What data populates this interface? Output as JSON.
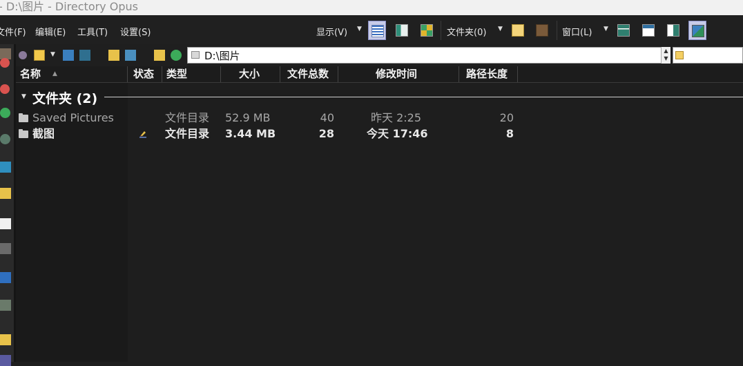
{
  "window": {
    "title": "- D:\\图片 - Directory Opus"
  },
  "menu": {
    "file": "文件(F)",
    "edit": "编辑(E)",
    "tools": "工具(T)",
    "settings": "设置(S)"
  },
  "toolbar": {
    "display_label": "显示(V)",
    "folder_label": "文件夹(0)",
    "window_label": "窗口(L)",
    "active_view_button": "details-view",
    "active_window_button": "layout-dual-image"
  },
  "location": {
    "path": "D:\\图片",
    "search_value": ""
  },
  "columns": [
    {
      "label": "名称",
      "sort": "ascending"
    },
    {
      "label": "状态"
    },
    {
      "label": "类型"
    },
    {
      "label": "大小"
    },
    {
      "label": "文件总数"
    },
    {
      "label": "修改时间"
    },
    {
      "label": "路径长度"
    }
  ],
  "group": {
    "label": "文件夹 (2)",
    "expanded": true
  },
  "files": [
    {
      "name": "Saved Pictures",
      "status_icon": "",
      "type": "文件目录",
      "size": "52.9 MB",
      "total_files": "40",
      "modified": "昨天 2:25",
      "path_length": "20",
      "style": "dim"
    },
    {
      "name": "截图",
      "status_icon": "edit-pencil-icon",
      "type": "文件目录",
      "size": "3.44 MB",
      "total_files": "28",
      "modified": "今天 17:46",
      "path_length": "8",
      "style": "bold"
    }
  ],
  "colors": {
    "background": "#1e1e1e",
    "titlebar": "#f1f1f1",
    "active_button": "#c7cbe8",
    "text_primary": "#e8e8e8",
    "text_dim": "#a7a7a7"
  }
}
